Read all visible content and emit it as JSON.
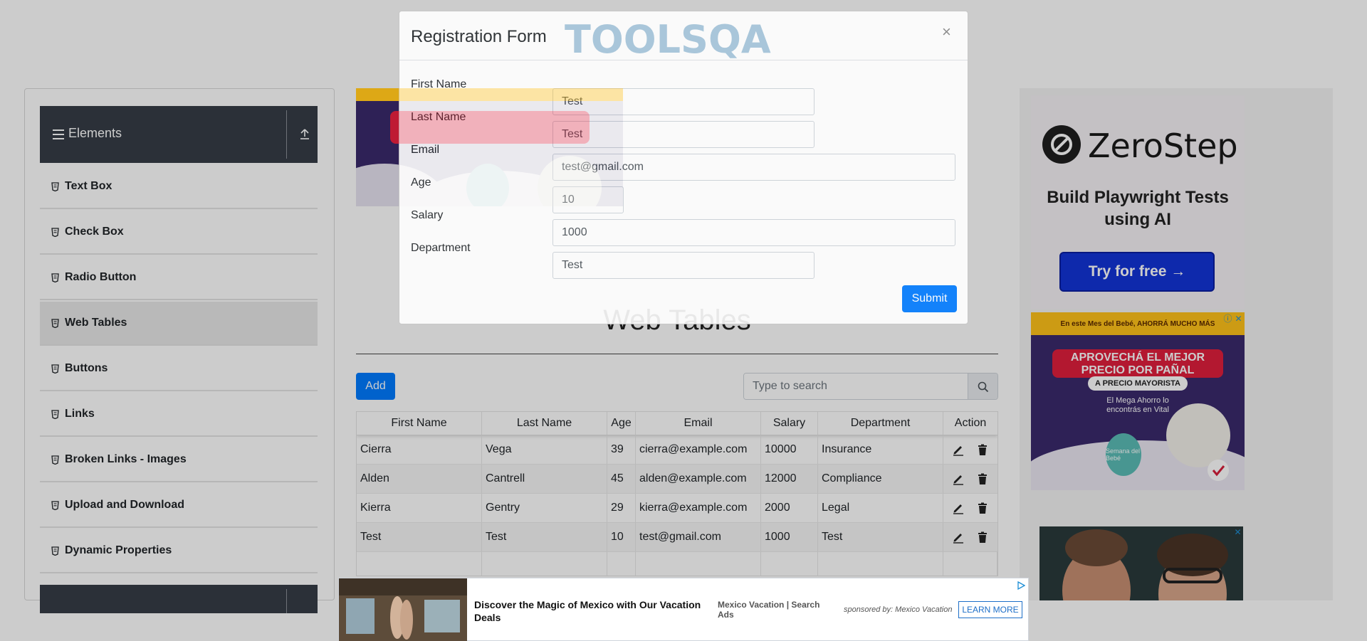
{
  "sidebar": {
    "group_title": "Elements",
    "items": [
      {
        "label": "Text Box",
        "active": false
      },
      {
        "label": "Check Box",
        "active": false
      },
      {
        "label": "Radio Button",
        "active": false
      },
      {
        "label": "Web Tables",
        "active": true
      },
      {
        "label": "Buttons",
        "active": false
      },
      {
        "label": "Links",
        "active": false
      },
      {
        "label": "Broken Links - Images",
        "active": false
      },
      {
        "label": "Upload and Download",
        "active": false
      },
      {
        "label": "Dynamic Properties",
        "active": false
      }
    ]
  },
  "main": {
    "page_title": "Web Tables",
    "add_label": "Add",
    "search_placeholder": "Type to search",
    "table": {
      "headers": [
        "First Name",
        "Last Name",
        "Age",
        "Email",
        "Salary",
        "Department",
        "Action"
      ],
      "rows": [
        [
          "Cierra",
          "Vega",
          "39",
          "cierra@example.com",
          "10000",
          "Insurance"
        ],
        [
          "Alden",
          "Cantrell",
          "45",
          "alden@example.com",
          "12000",
          "Compliance"
        ],
        [
          "Kierra",
          "Gentry",
          "29",
          "kierra@example.com",
          "2000",
          "Legal"
        ],
        [
          "Test",
          "Test",
          "10",
          "test@gmail.com",
          "1000",
          "Test"
        ]
      ]
    }
  },
  "modal": {
    "title": "Registration Form",
    "logo_text": "TOOLSQA",
    "close_label": "×",
    "fields": [
      {
        "label": "First Name",
        "value": "Test"
      },
      {
        "label": "Last Name",
        "value": "Test"
      },
      {
        "label": "Email",
        "value": "test@gmail.com"
      },
      {
        "label": "Age",
        "value": "10"
      },
      {
        "label": "Salary",
        "value": "1000"
      },
      {
        "label": "Department",
        "value": "Test"
      }
    ],
    "submit_label": "Submit"
  },
  "ads": {
    "zerostep": {
      "brand": "ZeroStep",
      "tagline": "Build Playwright Tests using AI",
      "cta": "Try for free →"
    },
    "vital": {
      "top": "En este Mes del Bebé, AHORRÁ MUCHO MÁS",
      "headline": "APROVECHÁ EL MEJOR PRECIO POR PAÑAL",
      "sub": "A PRECIO MAYORISTA",
      "copy": "El Mega Ahorro lo encontrás en Vital",
      "badge": "Semana del Bebé"
    },
    "bottom": {
      "headline": "Discover the Magic of Mexico with Our Vacation Deals",
      "source": "Mexico Vacation | Search Ads",
      "sponsor": "sponsored by: Mexico Vacation",
      "cta": "LEARN MORE"
    }
  },
  "colors": {
    "primary": "#007bff",
    "sidebar_header": "#363d47",
    "zerostep_button": "#1234d8"
  }
}
